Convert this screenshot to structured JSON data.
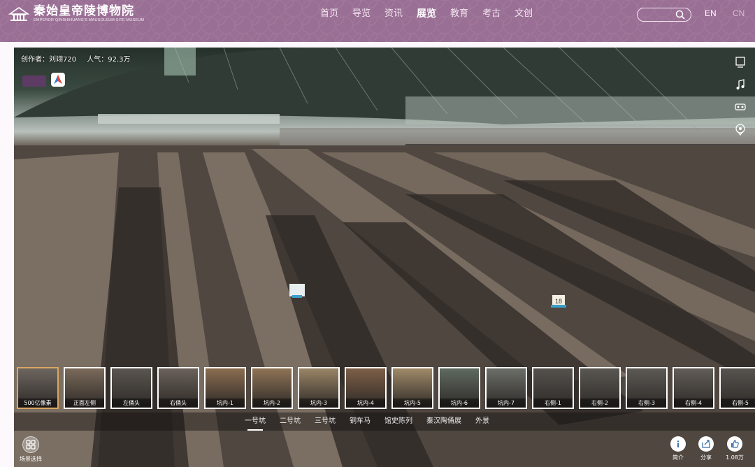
{
  "header": {
    "logo_title": "秦始皇帝陵博物院",
    "logo_subtitle": "EMPEROR QINSHIHUANG'S MAUSOLEUM SITE MUSEUM",
    "nav": [
      {
        "label": "首页",
        "active": false
      },
      {
        "label": "导览",
        "active": false
      },
      {
        "label": "资讯",
        "active": false
      },
      {
        "label": "展览",
        "active": true
      },
      {
        "label": "教育",
        "active": false
      },
      {
        "label": "考古",
        "active": false
      },
      {
        "label": "文创",
        "active": false
      }
    ],
    "search_placeholder": "",
    "lang_en": "EN",
    "lang_cn": "CN"
  },
  "viewer": {
    "creator": "创作者：刘翊720",
    "popularity": "人气：92.3万",
    "hotspot_number": "18",
    "thumbnails": [
      {
        "label": "500亿像素",
        "active": true
      },
      {
        "label": "正面左侧",
        "active": false
      },
      {
        "label": "左俑头",
        "active": false
      },
      {
        "label": "右俑头",
        "active": false
      },
      {
        "label": "坑内-1",
        "active": false
      },
      {
        "label": "坑内-2",
        "active": false
      },
      {
        "label": "坑内-3",
        "active": false
      },
      {
        "label": "坑内-4",
        "active": false
      },
      {
        "label": "坑内-5",
        "active": false
      },
      {
        "label": "坑内-6",
        "active": false
      },
      {
        "label": "坑内-7",
        "active": false
      },
      {
        "label": "右侧-1",
        "active": false
      },
      {
        "label": "右侧-2",
        "active": false
      },
      {
        "label": "右侧-3",
        "active": false
      },
      {
        "label": "右侧-4",
        "active": false
      },
      {
        "label": "右侧-5",
        "active": false
      }
    ],
    "categories": [
      {
        "label": "一号坑",
        "active": true
      },
      {
        "label": "二号坑",
        "active": false
      },
      {
        "label": "三号坑",
        "active": false
      },
      {
        "label": "铜车马",
        "active": false
      },
      {
        "label": "馆史陈列",
        "active": false
      },
      {
        "label": "秦汉陶俑展",
        "active": false
      },
      {
        "label": "外景",
        "active": false
      }
    ],
    "controls": {
      "scene_select": "场景选择",
      "intro": "简介",
      "share": "分享",
      "likes": "1.08万"
    }
  },
  "colors": {
    "header_bg": "#9a6f95",
    "thumb_active_border": "#d9a760"
  }
}
